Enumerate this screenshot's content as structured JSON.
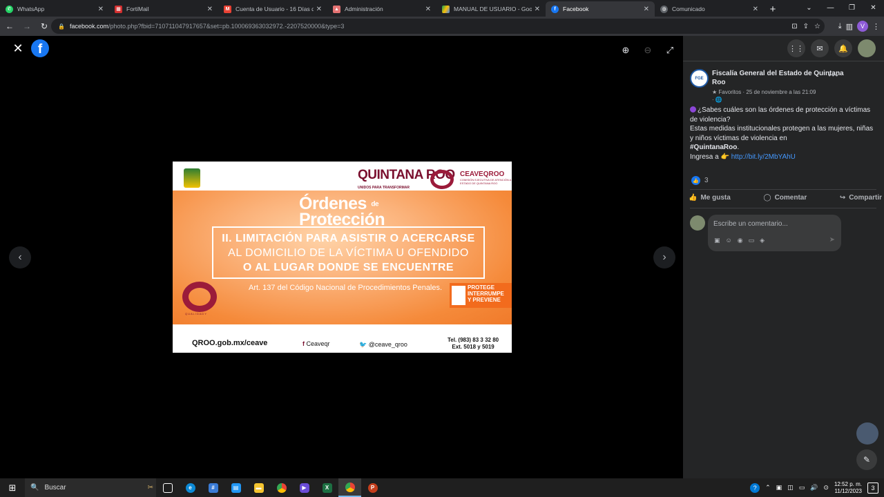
{
  "browser": {
    "tabs": [
      {
        "title": "WhatsApp",
        "icon": "whatsapp-icon",
        "color": "#25d366"
      },
      {
        "title": "FortiMail",
        "icon": "fortimail-icon",
        "color": "#d32f2f"
      },
      {
        "title": "Cuenta de Usuario - 16 Días de",
        "icon": "gmail-icon",
        "color": "#ea4335"
      },
      {
        "title": "Administración",
        "icon": "admin-icon",
        "color": "#e57373"
      },
      {
        "title": "MANUAL DE USUARIO - Googl",
        "icon": "drive-icon",
        "color": "#fbbc04"
      },
      {
        "title": "Facebook",
        "icon": "facebook-icon",
        "color": "#1877f2"
      },
      {
        "title": "Comunicado",
        "icon": "globe-icon",
        "color": "#9aa0a6"
      }
    ],
    "url_host": "facebook.com",
    "url_path": "/photo.php?fbid=710711047917657&set=pb.100069363032972.-2207520000&type=3"
  },
  "poster": {
    "top_qroo": "QUINTANA ROO",
    "top_qroo_sub": "UNIDOS PARA TRANSFORMAR",
    "ceaveqroo": "CEAVEQROO",
    "ceaveqroo_sub": "COMISIÓN EJECUTIVA DE ATENCIÓN A VÍCTIMAS DEL ESTADO DE QUINTANA ROO",
    "title_line1": "Órdenes",
    "title_de": "de",
    "title_line2": "Protección",
    "box_line1": "II. LIMITACIÓN PARA ASISTIR O ACERCARSE",
    "box_line2": "AL DOMICILIO DE LA VÍCTIMA U OFENDIDO",
    "box_line3": "O AL LUGAR DONDE SE ENCUENTRE",
    "article": "Art. 137 del Código Nacional de Procedimientos Penales.",
    "ring_label": "Q U A L I D A D Y",
    "protege_line1": "PROTEGE",
    "protege_line2": "INTERRUMPE",
    "protege_line3": "Y PREVIENE",
    "web": "QROO.gob.mx/ceave",
    "facebook": "Ceaveqr",
    "twitter": "@ceave_qroo",
    "tel": "Tel. (983)  83  3 32  80",
    "ext": "Ext. 5018 y 5019"
  },
  "post": {
    "author": "Fiscalía General del Estado de Quintana Roo",
    "avatar_text": "FGE",
    "meta_fav": "Favoritos",
    "meta_date": "· 25 de noviembre a las 21:09",
    "meta_aud": "· 🌐",
    "line1": "¿Sabes cuáles son las órdenes de protección a víctimas de violencia?",
    "line2": "Estas medidas institucionales protegen a las mujeres, niñas y niños víctimas de violencia en",
    "hashtag": "#QuintanaRoo",
    "line3_prefix": "Ingresa a 👉",
    "link": "http://bit.ly/2MbYAhU",
    "reactions": "3",
    "actions": {
      "like": "Me gusta",
      "comment": "Comentar",
      "share": "Compartir"
    },
    "comment_placeholder": "Escribe un comentario..."
  },
  "taskbar": {
    "search_label": "Buscar",
    "time": "12:52 p. m.",
    "date": "11/12/2023",
    "notifications": "3"
  }
}
